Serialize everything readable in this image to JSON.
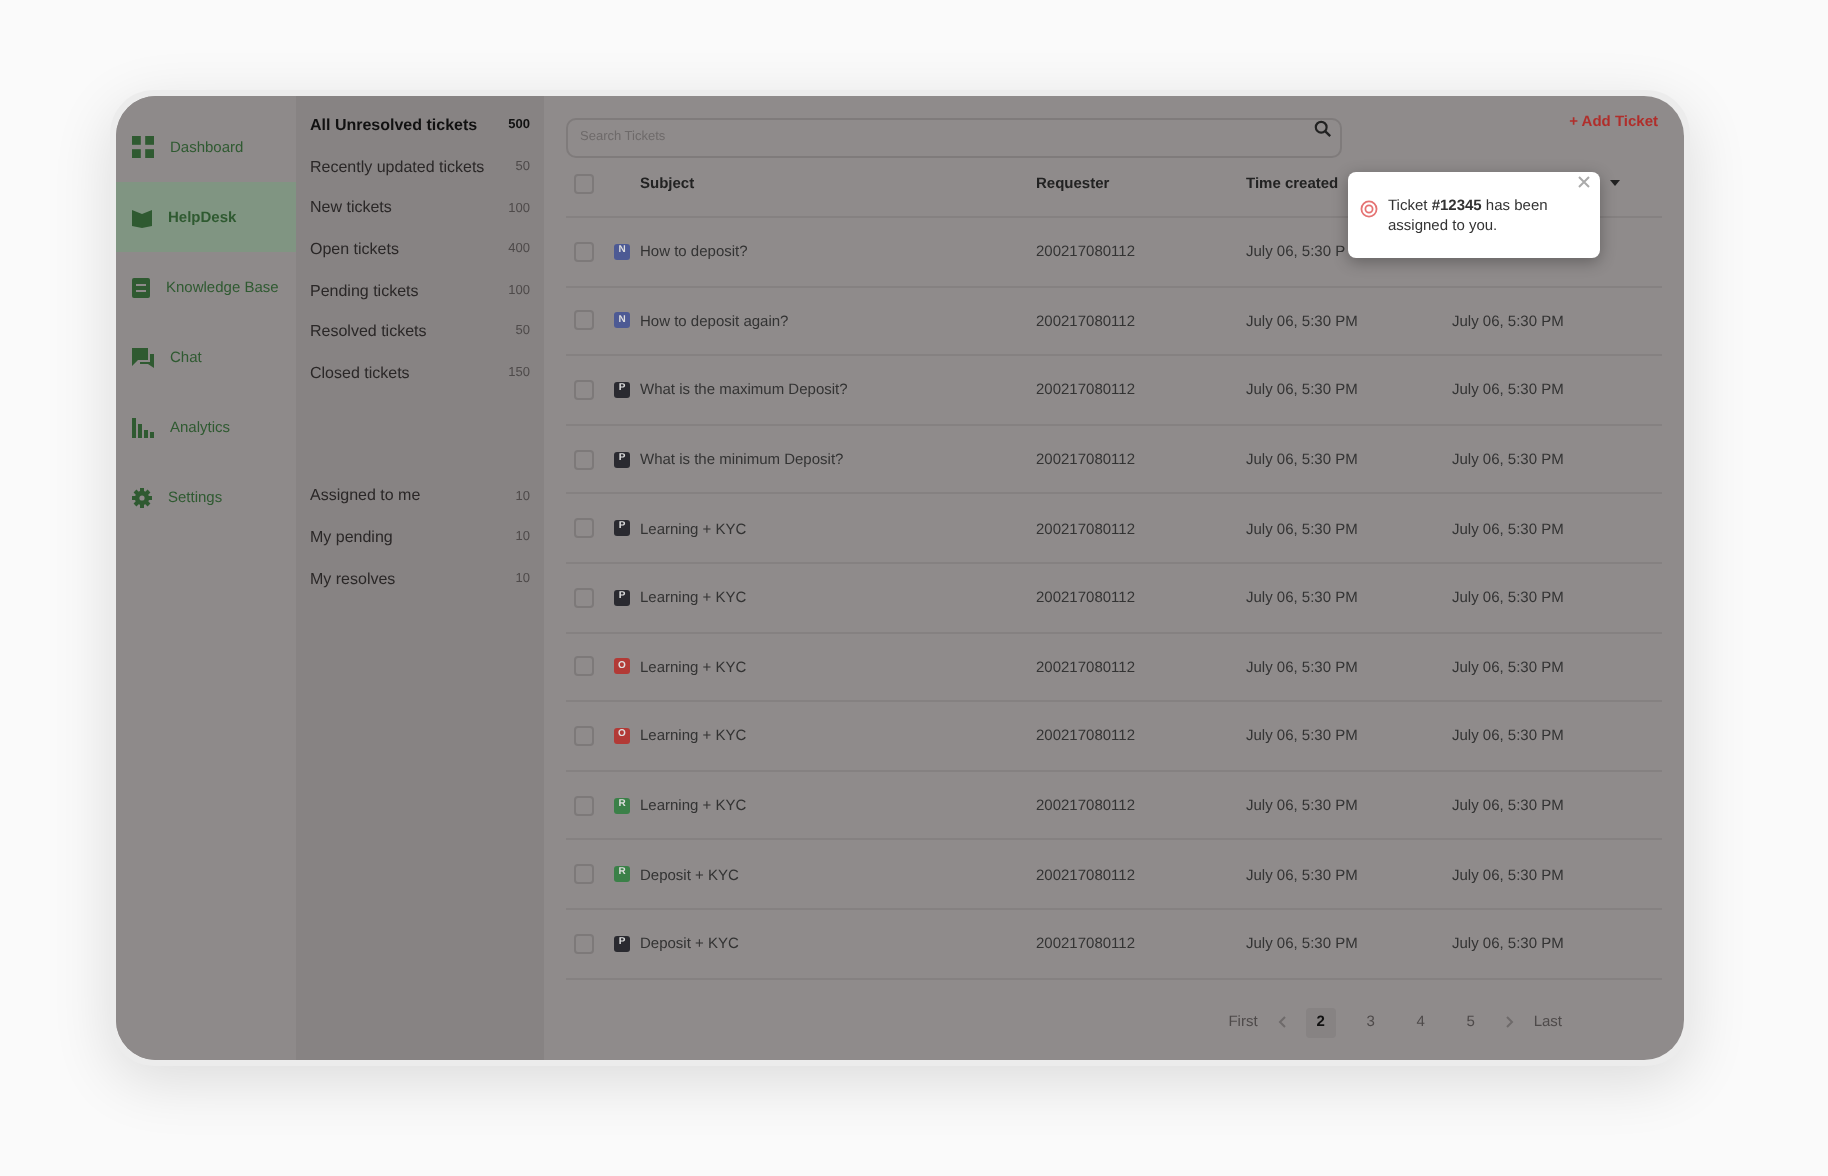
{
  "nav": [
    {
      "label": "Dashboard",
      "selected": false
    },
    {
      "label": "HelpDesk",
      "selected": true
    },
    {
      "label": "Knowledge Base",
      "selected": false
    },
    {
      "label": "Chat",
      "selected": false
    },
    {
      "label": "Analytics",
      "selected": false
    },
    {
      "label": "Settings",
      "selected": false
    }
  ],
  "views": [
    {
      "label": "All Unresolved tickets",
      "count": "500",
      "selected": true
    },
    {
      "label": "Recently updated tickets",
      "count": "50",
      "selected": false
    },
    {
      "label": "New tickets",
      "count": "100",
      "selected": false
    },
    {
      "label": "Open tickets",
      "count": "400",
      "selected": false
    },
    {
      "label": "Pending tickets",
      "count": "100",
      "selected": false
    },
    {
      "label": "Resolved tickets",
      "count": "50",
      "selected": false
    },
    {
      "label": "Closed tickets",
      "count": "150",
      "selected": false
    }
  ],
  "my_views": [
    {
      "label": "Assigned to me",
      "count": "10",
      "selected": false
    },
    {
      "label": "My pending",
      "count": "10",
      "selected": false
    },
    {
      "label": "My resolves",
      "count": "10",
      "selected": false
    }
  ],
  "search": {
    "placeholder": "Search Tickets"
  },
  "add_button": "+ Add Ticket",
  "table": {
    "select_all_checked": false,
    "columns": [
      "Subject",
      "Requester",
      "Time created"
    ],
    "rows": [
      {
        "checked": false,
        "badge": "N",
        "color": "#4d5a94",
        "subject": "How to deposit?",
        "requester": "200217080112",
        "time_created": "July 06, 5:30 P"
      },
      {
        "checked": false,
        "badge": "N",
        "color": "#4d5a94",
        "subject": "How to deposit again?",
        "requester": "200217080112",
        "time_created": "July 06, 5:30 PM",
        "column_4": "July 06, 5:30 PM"
      },
      {
        "checked": false,
        "badge": "P",
        "color": "#2a2a30",
        "subject": "What is the maximum Deposit?",
        "requester": "200217080112",
        "time_created": "July 06, 5:30 PM",
        "column_4": "July 06, 5:30 PM"
      },
      {
        "checked": false,
        "badge": "P",
        "color": "#2a2a30",
        "subject": "What is the minimum Deposit?",
        "requester": "200217080112",
        "time_created": "July 06, 5:30 PM",
        "column_4": "July 06, 5:30 PM"
      },
      {
        "checked": false,
        "badge": "P",
        "color": "#2a2a30",
        "subject": "Learning + KYC",
        "requester": "200217080112",
        "time_created": "July 06, 5:30 PM",
        "column_4": "July 06, 5:30 PM"
      },
      {
        "checked": false,
        "badge": "P",
        "color": "#2a2a30",
        "subject": "Learning + KYC",
        "requester": "200217080112",
        "time_created": "July 06, 5:30 PM",
        "column_4": "July 06, 5:30 PM"
      },
      {
        "checked": false,
        "badge": "O",
        "color": "#b23a36",
        "subject": "Learning + KYC",
        "requester": "200217080112",
        "time_created": "July 06, 5:30 PM",
        "column_4": "July 06, 5:30 PM"
      },
      {
        "checked": false,
        "badge": "O",
        "color": "#b23a36",
        "subject": "Learning + KYC",
        "requester": "200217080112",
        "time_created": "July 06, 5:30 PM",
        "column_4": "July 06, 5:30 PM"
      },
      {
        "checked": false,
        "badge": "R",
        "color": "#3b8048",
        "subject": "Learning + KYC",
        "requester": "200217080112",
        "time_created": "July 06, 5:30 PM",
        "column_4": "July 06, 5:30 PM"
      },
      {
        "checked": false,
        "badge": "R",
        "color": "#3b8048",
        "subject": "Deposit + KYC",
        "requester": "200217080112",
        "time_created": "July 06, 5:30 PM",
        "column_4": "July 06, 5:30 PM"
      },
      {
        "checked": false,
        "badge": "P",
        "color": "#2a2a30",
        "subject": "Deposit + KYC",
        "requester": "200217080112",
        "time_created": "July 06, 5:30 PM",
        "column_4": "July 06, 5:30 PM"
      }
    ]
  },
  "pagination": {
    "first": "First",
    "last": "Last",
    "pages": [
      {
        "label": "2",
        "selected": true
      },
      {
        "label": "3",
        "selected": false
      },
      {
        "label": "4",
        "selected": false
      },
      {
        "label": "5",
        "selected": false
      }
    ]
  },
  "toast": {
    "message": "Ticket **#12345** has been assigned to you."
  }
}
